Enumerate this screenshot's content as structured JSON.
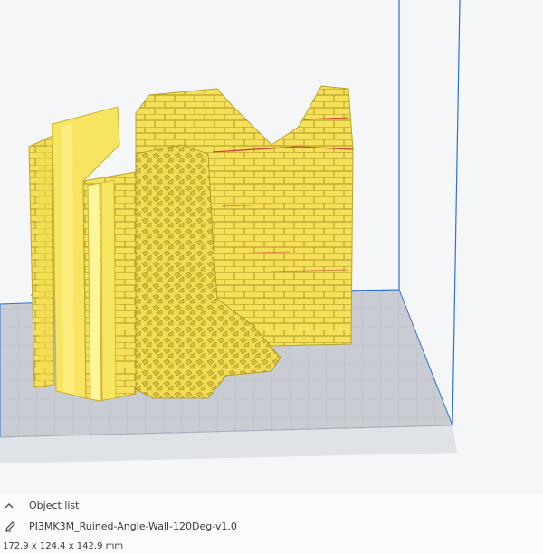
{
  "viewport": {
    "background": "#f5f6f8",
    "build_plate_color": "#c9cdd3",
    "build_volume_edge_color": "#2f6fd6",
    "model_color": "#f6e05a"
  },
  "object_list": {
    "header_label": "Object list",
    "toggle_icon": "chevron-up-icon",
    "edit_icon": "pencil-icon",
    "object_name": "PI3MK3M_Ruined-Angle-Wall-120Deg-v1.0",
    "dimensions": "172.9 x 124.4 x 142.9 mm"
  }
}
